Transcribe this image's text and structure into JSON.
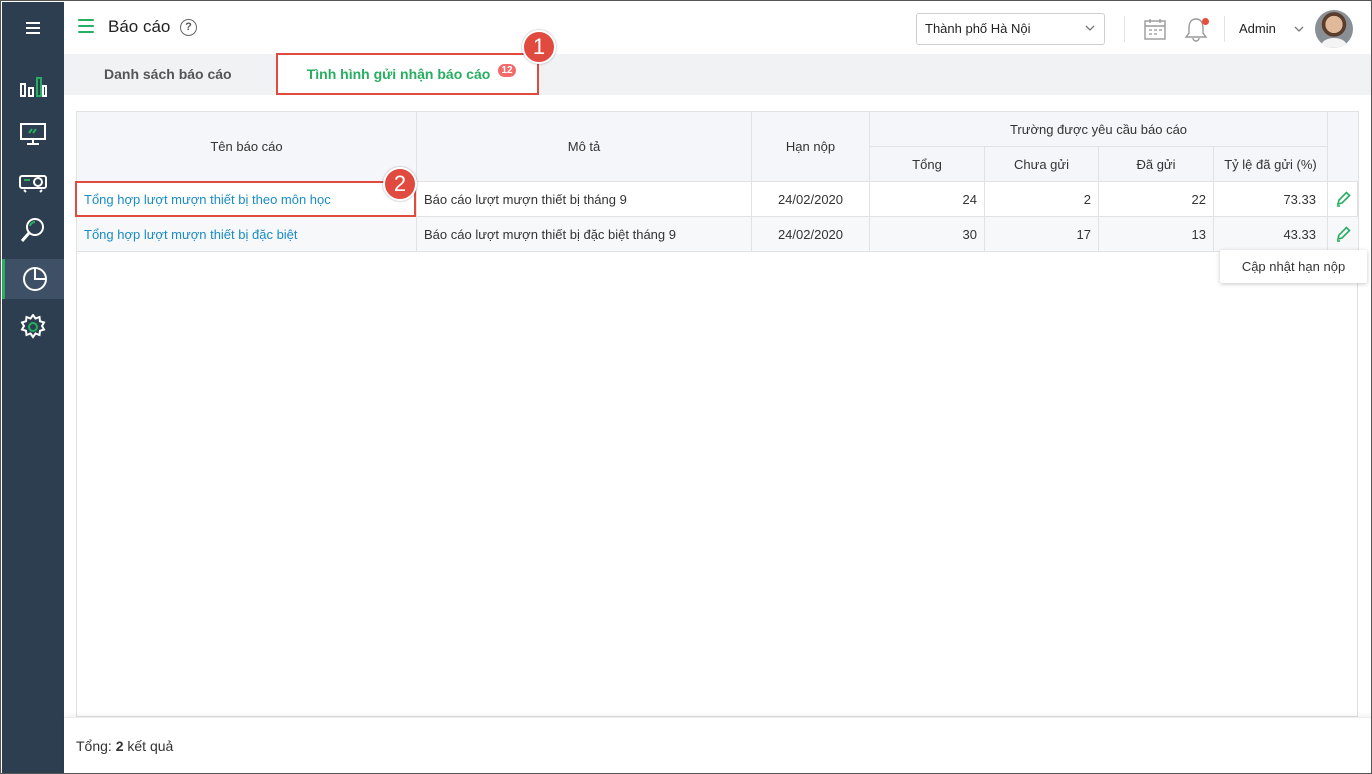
{
  "header": {
    "title": "Báo cáo",
    "help": "?",
    "city": "Thành phố Hà Nội",
    "user": "Admin"
  },
  "tabs": [
    {
      "label": "Danh sách báo cáo",
      "active": false
    },
    {
      "label": "Tình hình gửi nhận báo cáo",
      "active": true,
      "badge": "12"
    }
  ],
  "callouts": [
    "1",
    "2"
  ],
  "table": {
    "headers": {
      "name": "Tên báo cáo",
      "desc": "Mô tả",
      "deadline": "Hạn nộp",
      "group": "Trường được yêu cầu báo cáo",
      "total": "Tổng",
      "not_sent": "Chưa gửi",
      "sent": "Đã gửi",
      "rate": "Tỷ lệ đã gửi (%)"
    },
    "rows": [
      {
        "name": "Tổng hợp lượt mượn thiết bị theo môn học",
        "desc": "Báo cáo lượt mượn thiết bị tháng 9",
        "deadline": "24/02/2020",
        "total": "24",
        "not_sent": "2",
        "sent": "22",
        "rate": "73.33"
      },
      {
        "name": "Tổng hợp lượt mượn thiết bị đặc biệt",
        "desc": "Báo cáo lượt mượn thiết bị đặc biệt tháng 9",
        "deadline": "24/02/2020",
        "total": "30",
        "not_sent": "17",
        "sent": "13",
        "rate": "43.33"
      }
    ]
  },
  "tooltip": "Cập nhật hạn nộp",
  "footer": {
    "prefix": "Tổng:",
    "count": "2",
    "suffix": "kết quả"
  },
  "colors": {
    "accent": "#27ae60",
    "sidebar": "#2c3e50",
    "highlight": "#e04a3f",
    "link": "#1a8cc4"
  },
  "icons": [
    "menu-icon",
    "bar-chart-icon",
    "monitor-icon",
    "projector-icon",
    "search-icon",
    "pie-chart-icon",
    "settings-icon",
    "calendar-icon",
    "bell-icon",
    "edit-icon"
  ]
}
